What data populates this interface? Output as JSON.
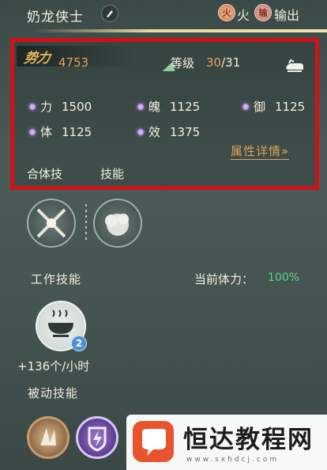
{
  "header": {
    "name": "奶龙侠士",
    "element_badge": "火",
    "element": "火",
    "role_badge": "输",
    "role": "输出"
  },
  "stats": {
    "power_label": "势力",
    "power": "4753",
    "level_label": "等级",
    "level": "30",
    "level_max": "/31",
    "attributes": [
      {
        "label": "力",
        "value": "1500"
      },
      {
        "label": "魄",
        "value": "1125"
      },
      {
        "label": "御",
        "value": "1125"
      },
      {
        "label": "体",
        "value": "1125"
      },
      {
        "label": "效",
        "value": "1375"
      }
    ],
    "detail_link": "属性详情»",
    "tabs": [
      "合体技",
      "技能"
    ]
  },
  "work": {
    "title": "工作技能",
    "stamina_label": "当前体力：",
    "stamina_value": "100%",
    "badge": "2",
    "rate": "+136个/小时"
  },
  "passive": {
    "title": "被动技能"
  },
  "watermark": {
    "title": "恒达教程网",
    "url": "www.sxhdcj.com"
  },
  "colors": {
    "highlight_border": "#d01218",
    "accent_orange": "#e4a25c",
    "stamina_green": "#5fd28a"
  }
}
